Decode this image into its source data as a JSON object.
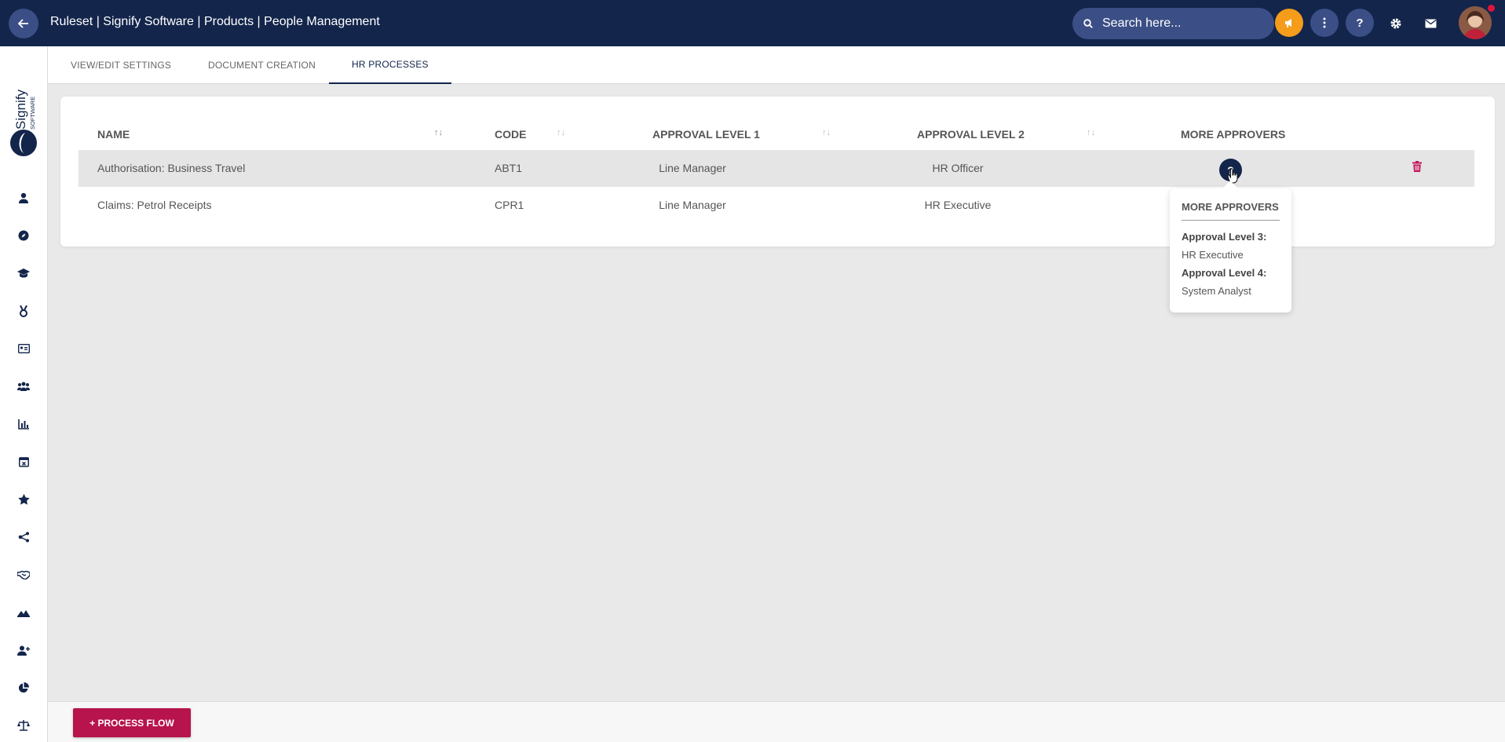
{
  "topbar": {
    "title": "Ruleset | Signify Software | Products | People Management",
    "search_placeholder": "Search here...",
    "help_label": "?"
  },
  "logo": {
    "text": "Signify",
    "subtext": "SOFTWARE"
  },
  "tabs": [
    {
      "label": "VIEW/EDIT SETTINGS"
    },
    {
      "label": "DOCUMENT CREATION"
    },
    {
      "label": "HR PROCESSES",
      "active": true
    }
  ],
  "table": {
    "headers": [
      "NAME",
      "CODE",
      "APPROVAL LEVEL 1",
      "APPROVAL LEVEL 2",
      "MORE APPROVERS"
    ],
    "rows": [
      {
        "name": "Authorisation: Business Travel",
        "code": "ABT1",
        "level1": "Line Manager",
        "level2": "HR Officer"
      },
      {
        "name": "Claims: Petrol Receipts",
        "code": "CPR1",
        "level1": "Line Manager",
        "level2": "HR Executive"
      }
    ],
    "more_button_label": "?"
  },
  "popover": {
    "title": "MORE APPROVERS",
    "items": [
      {
        "label": "Approval Level 3:",
        "value": "HR Executive"
      },
      {
        "label": "Approval Level 4:",
        "value": "System Analyst"
      }
    ]
  },
  "footer": {
    "process_flow_label": "+ PROCESS FLOW"
  },
  "colors": {
    "navy": "#13254b",
    "navy_light": "#3b4f86",
    "accent_orange": "#f59c1a",
    "accent_red": "#b7134c"
  }
}
